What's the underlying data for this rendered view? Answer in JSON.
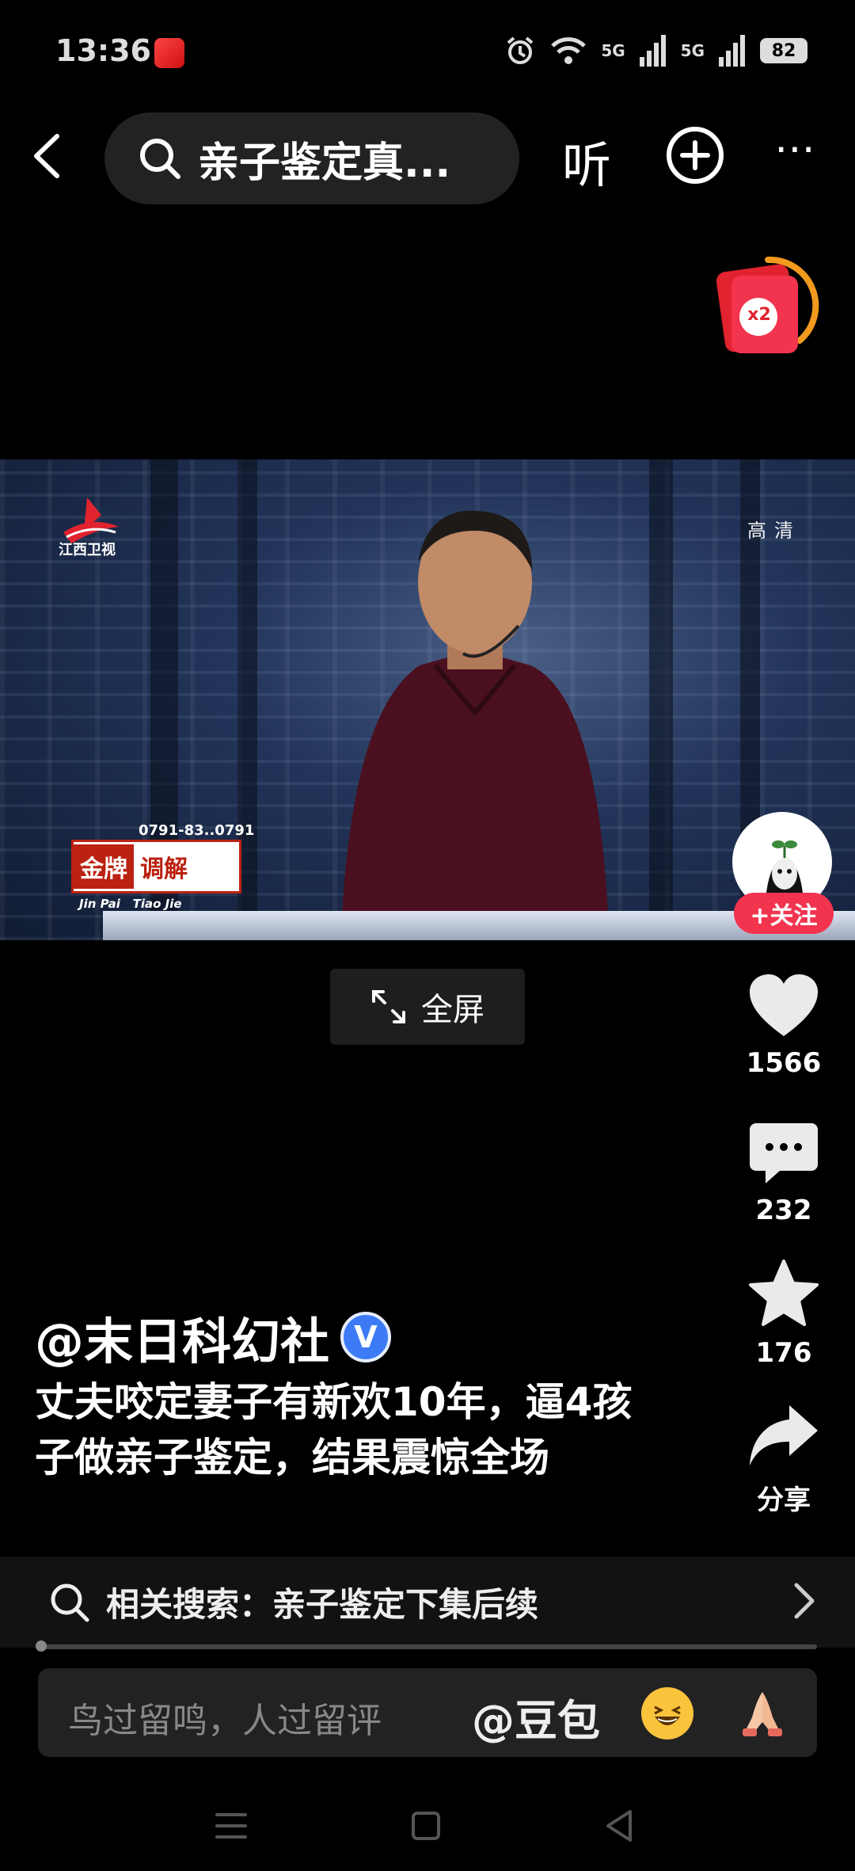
{
  "status_bar": {
    "time": "13:36",
    "signal1": "5G",
    "signal2": "5G",
    "battery": "82"
  },
  "top_nav": {
    "search_query": "亲子鉴定真...",
    "listen_label": "听",
    "more_label": "⋯"
  },
  "red_packet": {
    "label": "x2"
  },
  "video": {
    "channel": "江西卫视",
    "quality": "高清",
    "phone": "0791-83..0791",
    "show_name_a": "金牌",
    "show_name_b": "调解",
    "show_pinyin": "Jin Pai   Tiao Jie"
  },
  "fullscreen_label": "全屏",
  "actions": {
    "follow_label": "+关注",
    "likes": "1566",
    "comments": "232",
    "favorites": "176",
    "share_label": "分享"
  },
  "post": {
    "author": "@末日科幻社",
    "description": "丈夫咬定妻子有新欢10年，逼4孩子做亲子鉴定，结果震惊全场"
  },
  "related": {
    "label": "相关搜索：亲子鉴定下集后续"
  },
  "progress": {
    "value": 0.004
  },
  "comment_bar": {
    "placeholder": "鸟过留鸣，人过留评",
    "mention": "@豆包"
  },
  "colors": {
    "accent_red": "#f2344f",
    "verified_blue": "#3d7bf6"
  }
}
